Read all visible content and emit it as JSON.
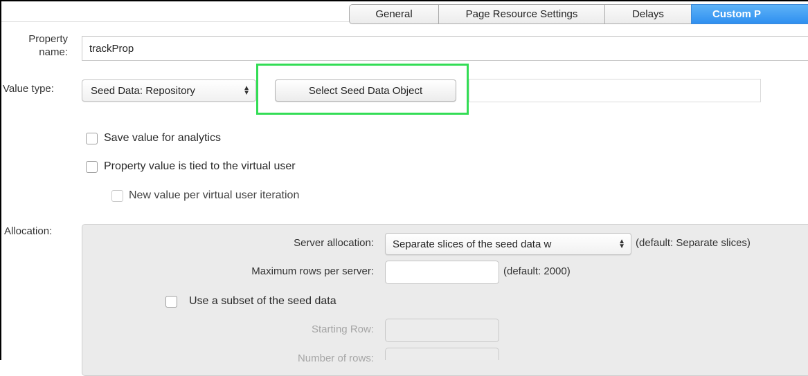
{
  "tabs": [
    {
      "label": "General",
      "active": false
    },
    {
      "label": "Page Resource Settings",
      "active": false
    },
    {
      "label": "Delays",
      "active": false
    },
    {
      "label": "Custom P",
      "active": true
    }
  ],
  "property_name": {
    "label": "Property name:",
    "label_line1": "Property",
    "label_line2": "name:",
    "value": "trackProp"
  },
  "value_type": {
    "label": "Value type:",
    "selected": "Seed Data: Repository",
    "button_label": "Select Seed Data Object",
    "field_value": ""
  },
  "options": {
    "save_analytics": {
      "label": "Save value for analytics",
      "checked": false
    },
    "tied_virtual_user": {
      "label": "Property value is tied to the virtual user",
      "checked": false
    },
    "new_value_per_iteration": {
      "label": "New value per virtual user iteration",
      "checked": false,
      "enabled": false
    }
  },
  "allocation": {
    "label": "Allocation:",
    "server_allocation": {
      "label": "Server allocation:",
      "selected": "Separate slices of the seed data w",
      "hint": "(default: Separate slices)"
    },
    "max_rows": {
      "label": "Maximum rows per server:",
      "value": "",
      "hint": "(default: 2000)"
    },
    "use_subset": {
      "label": "Use a subset of the seed data",
      "checked": false
    },
    "starting_row": {
      "label": "Starting Row:",
      "value": ""
    },
    "number_of_rows": {
      "label": "Number of rows:",
      "value": ""
    }
  },
  "colors": {
    "active_tab": "#2f8ff0",
    "highlight": "#33dd55",
    "panel_bg": "#ebebeb"
  }
}
